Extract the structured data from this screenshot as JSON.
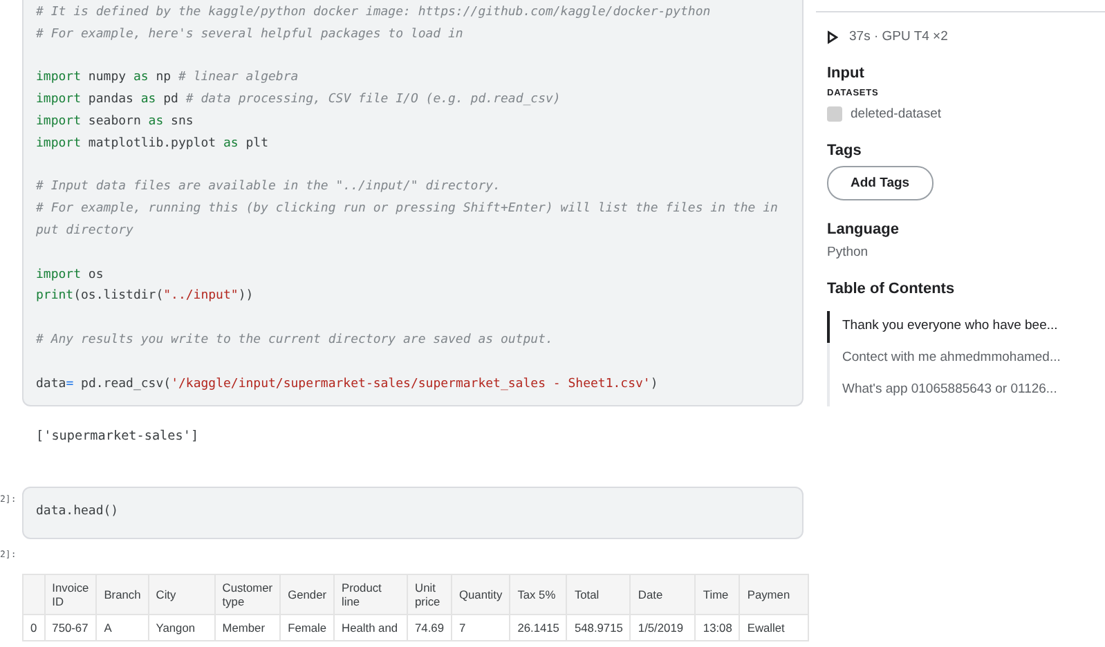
{
  "code_cell": {
    "lines": [
      {
        "blank_before": false,
        "tokens": [
          {
            "kind": "comment",
            "text": "# It is defined by the kaggle/python docker image: https://github.com/kaggle/docker-python"
          }
        ]
      },
      {
        "blank_before": false,
        "tokens": [
          {
            "kind": "comment",
            "text": "# For example, here's several helpful packages to load in"
          }
        ]
      },
      {
        "blank_before": true,
        "tokens": [
          {
            "kind": "keyword",
            "text": "import"
          },
          {
            "kind": "plain",
            "text": " numpy "
          },
          {
            "kind": "keyword",
            "text": "as"
          },
          {
            "kind": "plain",
            "text": " np "
          },
          {
            "kind": "comment",
            "text": "# linear algebra"
          }
        ]
      },
      {
        "blank_before": false,
        "tokens": [
          {
            "kind": "keyword",
            "text": "import"
          },
          {
            "kind": "plain",
            "text": " pandas "
          },
          {
            "kind": "keyword",
            "text": "as"
          },
          {
            "kind": "plain",
            "text": " pd "
          },
          {
            "kind": "comment",
            "text": "# data processing, CSV file I/O (e.g. pd.read_csv)"
          }
        ]
      },
      {
        "blank_before": false,
        "tokens": [
          {
            "kind": "keyword",
            "text": "import"
          },
          {
            "kind": "plain",
            "text": " seaborn "
          },
          {
            "kind": "keyword",
            "text": "as"
          },
          {
            "kind": "plain",
            "text": " sns"
          }
        ]
      },
      {
        "blank_before": false,
        "tokens": [
          {
            "kind": "keyword",
            "text": "import"
          },
          {
            "kind": "plain",
            "text": " matplotlib.pyplot "
          },
          {
            "kind": "keyword",
            "text": "as"
          },
          {
            "kind": "plain",
            "text": " plt"
          }
        ]
      },
      {
        "blank_before": true,
        "tokens": [
          {
            "kind": "comment",
            "text": "# Input data files are available in the \"../input/\" directory."
          }
        ]
      },
      {
        "blank_before": false,
        "tokens": [
          {
            "kind": "comment",
            "text": "# For example, running this (by clicking run or pressing Shift+Enter) will list the files in the in"
          }
        ]
      },
      {
        "blank_before": false,
        "tokens": [
          {
            "kind": "comment",
            "text": "put directory"
          }
        ]
      },
      {
        "blank_before": true,
        "tokens": [
          {
            "kind": "keyword",
            "text": "import"
          },
          {
            "kind": "plain",
            "text": " os"
          }
        ]
      },
      {
        "blank_before": false,
        "tokens": [
          {
            "kind": "keyword",
            "text": "print"
          },
          {
            "kind": "plain",
            "text": "(os.listdir("
          },
          {
            "kind": "string",
            "text": "\"../input\""
          },
          {
            "kind": "plain",
            "text": "))"
          }
        ]
      },
      {
        "blank_before": true,
        "tokens": [
          {
            "kind": "comment",
            "text": "# Any results you write to the current directory are saved as output."
          }
        ]
      },
      {
        "blank_before": true,
        "tokens": [
          {
            "kind": "plain",
            "text": "data"
          },
          {
            "kind": "operator",
            "text": "="
          },
          {
            "kind": "plain",
            "text": " pd.read_csv("
          },
          {
            "kind": "string",
            "text": "'/kaggle/input/supermarket-sales/supermarket_sales - Sheet1.csv'"
          },
          {
            "kind": "plain",
            "text": ")"
          }
        ]
      }
    ]
  },
  "output_1": {
    "text": "['supermarket-sales']"
  },
  "code_cell_2": {
    "prompt": "2]:",
    "code": "data.head()"
  },
  "output_2": {
    "prompt": "2]:",
    "table": {
      "columns": [
        "",
        "Invoice ID",
        "Branch",
        "City",
        "Customer type",
        "Gender",
        "Product line",
        "Unit price",
        "Quantity",
        "Tax 5%",
        "Total",
        "Date",
        "Time",
        "Paymen"
      ],
      "rows": [
        [
          "0",
          "750-67",
          "A",
          "Yangon",
          "Member",
          "Female",
          "Health and",
          "74.69",
          "7",
          "26.1415",
          "548.9715",
          "1/5/2019",
          "13:08",
          "Ewallet"
        ]
      ]
    }
  },
  "sidebar": {
    "runtime": "37s · GPU T4 ×2",
    "input_heading": "Input",
    "datasets_label": "DATASETS",
    "datasets": [
      "deleted-dataset"
    ],
    "tags_heading": "Tags",
    "add_tags_button": "Add Tags",
    "language_heading": "Language",
    "language": "Python",
    "toc_heading": "Table of Contents",
    "toc": [
      {
        "text": "Thank you everyone who have bee...",
        "selected": true
      },
      {
        "text": "Contect with me ahmedmmohamed...",
        "selected": false
      },
      {
        "text": "What's app 01065885643 or 01126...",
        "selected": false
      }
    ]
  }
}
